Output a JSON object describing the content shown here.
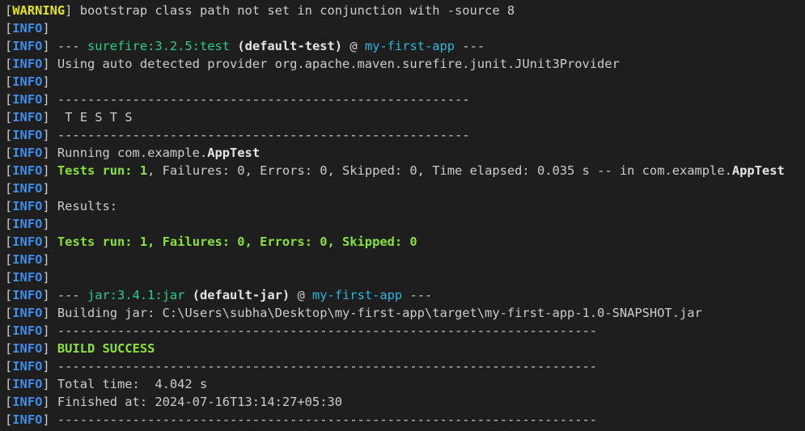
{
  "terminal": {
    "lines": [
      {
        "segments": [
          {
            "text": "[",
            "style": "plain"
          },
          {
            "text": "WARNING",
            "style": "warn"
          },
          {
            "text": "] bootstrap class path not set in conjunction with -source 8",
            "style": "plain"
          }
        ]
      },
      {
        "segments": [
          {
            "text": "[",
            "style": "plain"
          },
          {
            "text": "INFO",
            "style": "info"
          },
          {
            "text": "]",
            "style": "plain"
          }
        ]
      },
      {
        "segments": [
          {
            "text": "[",
            "style": "plain"
          },
          {
            "text": "INFO",
            "style": "info"
          },
          {
            "text": "] --- ",
            "style": "plain"
          },
          {
            "text": "surefire:3.2.5:test",
            "style": "green"
          },
          {
            "text": " ",
            "style": "plain"
          },
          {
            "text": "(default-test)",
            "style": "bold"
          },
          {
            "text": " @ ",
            "style": "plain"
          },
          {
            "text": "my-first-app",
            "style": "cyan"
          },
          {
            "text": " ---",
            "style": "plain"
          }
        ]
      },
      {
        "segments": [
          {
            "text": "[",
            "style": "plain"
          },
          {
            "text": "INFO",
            "style": "info"
          },
          {
            "text": "] Using auto detected provider org.apache.maven.surefire.junit.JUnit3Provider",
            "style": "plain"
          }
        ]
      },
      {
        "segments": [
          {
            "text": "[",
            "style": "plain"
          },
          {
            "text": "INFO",
            "style": "info"
          },
          {
            "text": "]",
            "style": "plain"
          }
        ]
      },
      {
        "segments": [
          {
            "text": "[",
            "style": "plain"
          },
          {
            "text": "INFO",
            "style": "info"
          },
          {
            "text": "] -------------------------------------------------------",
            "style": "plain"
          }
        ]
      },
      {
        "segments": [
          {
            "text": "[",
            "style": "plain"
          },
          {
            "text": "INFO",
            "style": "info"
          },
          {
            "text": "]  T E S T S",
            "style": "plain"
          }
        ]
      },
      {
        "segments": [
          {
            "text": "[",
            "style": "plain"
          },
          {
            "text": "INFO",
            "style": "info"
          },
          {
            "text": "] -------------------------------------------------------",
            "style": "plain"
          }
        ]
      },
      {
        "segments": [
          {
            "text": "[",
            "style": "plain"
          },
          {
            "text": "INFO",
            "style": "info"
          },
          {
            "text": "] Running com.example.",
            "style": "plain"
          },
          {
            "text": "AppTest",
            "style": "bold"
          }
        ]
      },
      {
        "segments": [
          {
            "text": "[",
            "style": "plain"
          },
          {
            "text": "INFO",
            "style": "info"
          },
          {
            "text": "] ",
            "style": "plain"
          },
          {
            "text": "Tests run: 1",
            "style": "greenbold"
          },
          {
            "text": ", Failures: 0, Errors: 0, Skipped: 0, Time elapsed: 0.035 s -- in com.example.",
            "style": "plain"
          },
          {
            "text": "AppTest",
            "style": "bold"
          }
        ]
      },
      {
        "segments": [
          {
            "text": "[",
            "style": "plain"
          },
          {
            "text": "INFO",
            "style": "info"
          },
          {
            "text": "]",
            "style": "plain"
          }
        ]
      },
      {
        "segments": [
          {
            "text": "[",
            "style": "plain"
          },
          {
            "text": "INFO",
            "style": "info"
          },
          {
            "text": "] Results:",
            "style": "plain"
          }
        ]
      },
      {
        "segments": [
          {
            "text": "[",
            "style": "plain"
          },
          {
            "text": "INFO",
            "style": "info"
          },
          {
            "text": "]",
            "style": "plain"
          }
        ]
      },
      {
        "segments": [
          {
            "text": "[",
            "style": "plain"
          },
          {
            "text": "INFO",
            "style": "info"
          },
          {
            "text": "] ",
            "style": "plain"
          },
          {
            "text": "Tests run: 1, Failures: 0, Errors: 0, Skipped: 0",
            "style": "greenbold"
          }
        ]
      },
      {
        "segments": [
          {
            "text": "[",
            "style": "plain"
          },
          {
            "text": "INFO",
            "style": "info"
          },
          {
            "text": "]",
            "style": "plain"
          }
        ]
      },
      {
        "segments": [
          {
            "text": "[",
            "style": "plain"
          },
          {
            "text": "INFO",
            "style": "info"
          },
          {
            "text": "]",
            "style": "plain"
          }
        ]
      },
      {
        "segments": [
          {
            "text": "[",
            "style": "plain"
          },
          {
            "text": "INFO",
            "style": "info"
          },
          {
            "text": "] --- ",
            "style": "plain"
          },
          {
            "text": "jar:3.4.1:jar",
            "style": "green"
          },
          {
            "text": " ",
            "style": "plain"
          },
          {
            "text": "(default-jar)",
            "style": "bold"
          },
          {
            "text": " @ ",
            "style": "plain"
          },
          {
            "text": "my-first-app",
            "style": "cyan"
          },
          {
            "text": " ---",
            "style": "plain"
          }
        ]
      },
      {
        "segments": [
          {
            "text": "[",
            "style": "plain"
          },
          {
            "text": "INFO",
            "style": "info"
          },
          {
            "text": "] Building jar: C:\\Users\\subha\\Desktop\\my-first-app\\target\\my-first-app-1.0-SNAPSHOT.jar",
            "style": "plain"
          }
        ]
      },
      {
        "segments": [
          {
            "text": "[",
            "style": "plain"
          },
          {
            "text": "INFO",
            "style": "info"
          },
          {
            "text": "] ------------------------------------------------------------------------",
            "style": "plain"
          }
        ]
      },
      {
        "segments": [
          {
            "text": "[",
            "style": "plain"
          },
          {
            "text": "INFO",
            "style": "info"
          },
          {
            "text": "] ",
            "style": "plain"
          },
          {
            "text": "BUILD SUCCESS",
            "style": "greenbold"
          }
        ]
      },
      {
        "segments": [
          {
            "text": "[",
            "style": "plain"
          },
          {
            "text": "INFO",
            "style": "info"
          },
          {
            "text": "] ------------------------------------------------------------------------",
            "style": "plain"
          }
        ]
      },
      {
        "segments": [
          {
            "text": "[",
            "style": "plain"
          },
          {
            "text": "INFO",
            "style": "info"
          },
          {
            "text": "] Total time:  4.042 s",
            "style": "plain"
          }
        ]
      },
      {
        "segments": [
          {
            "text": "[",
            "style": "plain"
          },
          {
            "text": "INFO",
            "style": "info"
          },
          {
            "text": "] Finished at: 2024-07-16T13:14:27+05:30",
            "style": "plain"
          }
        ]
      },
      {
        "segments": [
          {
            "text": "[",
            "style": "plain"
          },
          {
            "text": "INFO",
            "style": "info"
          },
          {
            "text": "] ------------------------------------------------------------------------",
            "style": "plain"
          }
        ]
      }
    ]
  },
  "colors": {
    "background": "#1e1e1e",
    "text": "#cccccc",
    "info_tag": "#3b8eea",
    "warning_tag": "#e5e510",
    "plugin_green": "#23d18b",
    "success_green": "#8ae234",
    "project_cyan": "#29b8db"
  }
}
